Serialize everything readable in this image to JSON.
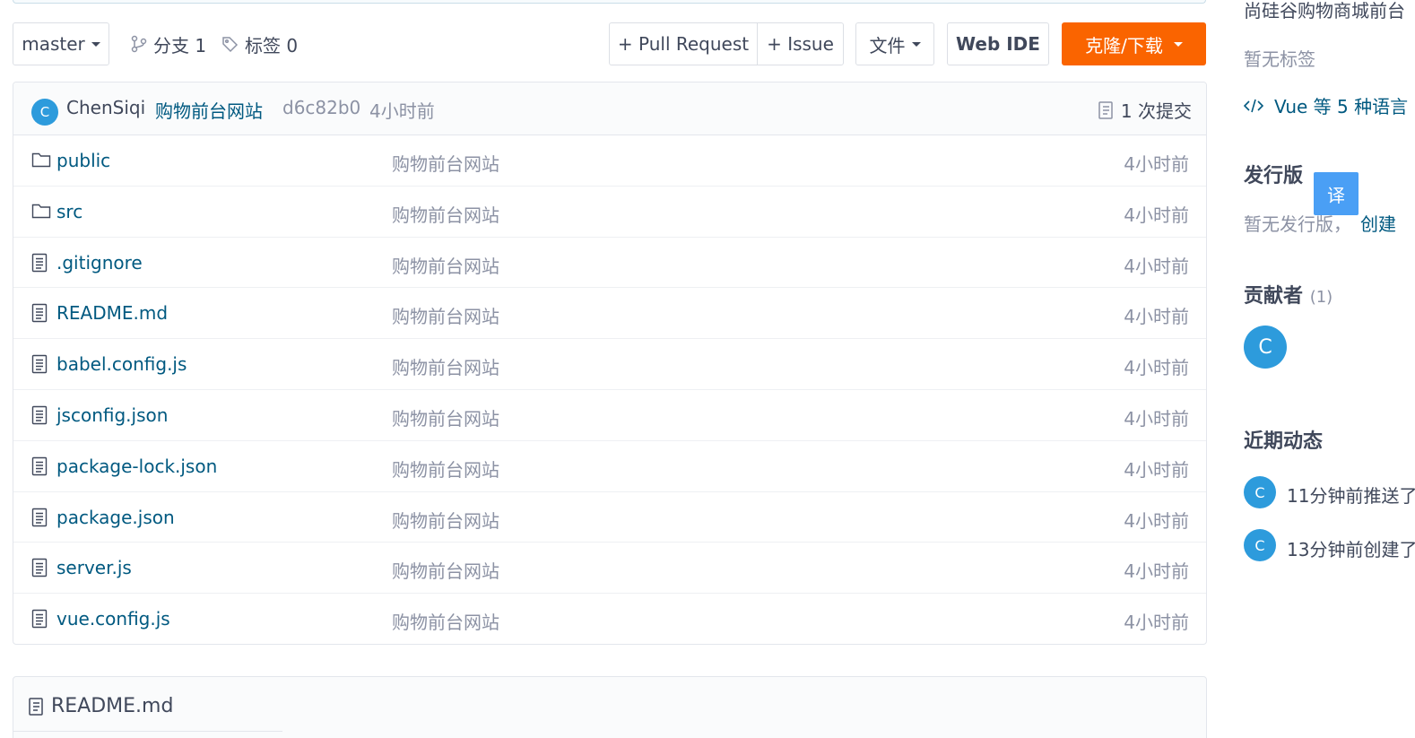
{
  "toolbar": {
    "branch": "master",
    "branches_label": "分支 1",
    "tags_label": "标签 0",
    "pull_request": "+ Pull Request",
    "issue": "+ Issue",
    "files": "文件",
    "web_ide": "Web IDE",
    "clone": "克隆/下载"
  },
  "commit": {
    "avatar": "C",
    "author": "ChenSiqi",
    "message": "购物前台网站",
    "hash": "d6c82b0",
    "time": "4小时前",
    "count_label": "1 次提交"
  },
  "files": [
    {
      "type": "folder",
      "name": "public",
      "message": "购物前台网站",
      "time": "4小时前"
    },
    {
      "type": "folder",
      "name": "src",
      "message": "购物前台网站",
      "time": "4小时前"
    },
    {
      "type": "file",
      "name": ".gitignore",
      "message": "购物前台网站",
      "time": "4小时前"
    },
    {
      "type": "file",
      "name": "README.md",
      "message": "购物前台网站",
      "time": "4小时前"
    },
    {
      "type": "file",
      "name": "babel.config.js",
      "message": "购物前台网站",
      "time": "4小时前"
    },
    {
      "type": "file",
      "name": "jsconfig.json",
      "message": "购物前台网站",
      "time": "4小时前"
    },
    {
      "type": "file",
      "name": "package-lock.json",
      "message": "购物前台网站",
      "time": "4小时前"
    },
    {
      "type": "file",
      "name": "package.json",
      "message": "购物前台网站",
      "time": "4小时前"
    },
    {
      "type": "file",
      "name": "server.js",
      "message": "购物前台网站",
      "time": "4小时前"
    },
    {
      "type": "file",
      "name": "vue.config.js",
      "message": "购物前台网站",
      "time": "4小时前"
    }
  ],
  "readme": {
    "title": "README.md"
  },
  "sidebar": {
    "description": "尚硅谷购物商城前台",
    "tags_empty": "暂无标签",
    "languages": "Vue 等 5 种语言",
    "releases_heading": "发行版",
    "releases_empty": "暂无发行版，",
    "releases_create": "创建",
    "translate": "译",
    "contributors_heading": "贡献者",
    "contributors_count": "(1)",
    "contributor_avatar": "C",
    "activity_heading": "近期动态",
    "activity": [
      {
        "avatar": "C",
        "text": "11分钟前推送了"
      },
      {
        "avatar": "C",
        "text": "13分钟前创建了"
      }
    ]
  },
  "colors": {
    "accent": "#fa6400",
    "link": "#005980",
    "avatar": "#2d9bdc",
    "translate": "#4a9ff5"
  }
}
